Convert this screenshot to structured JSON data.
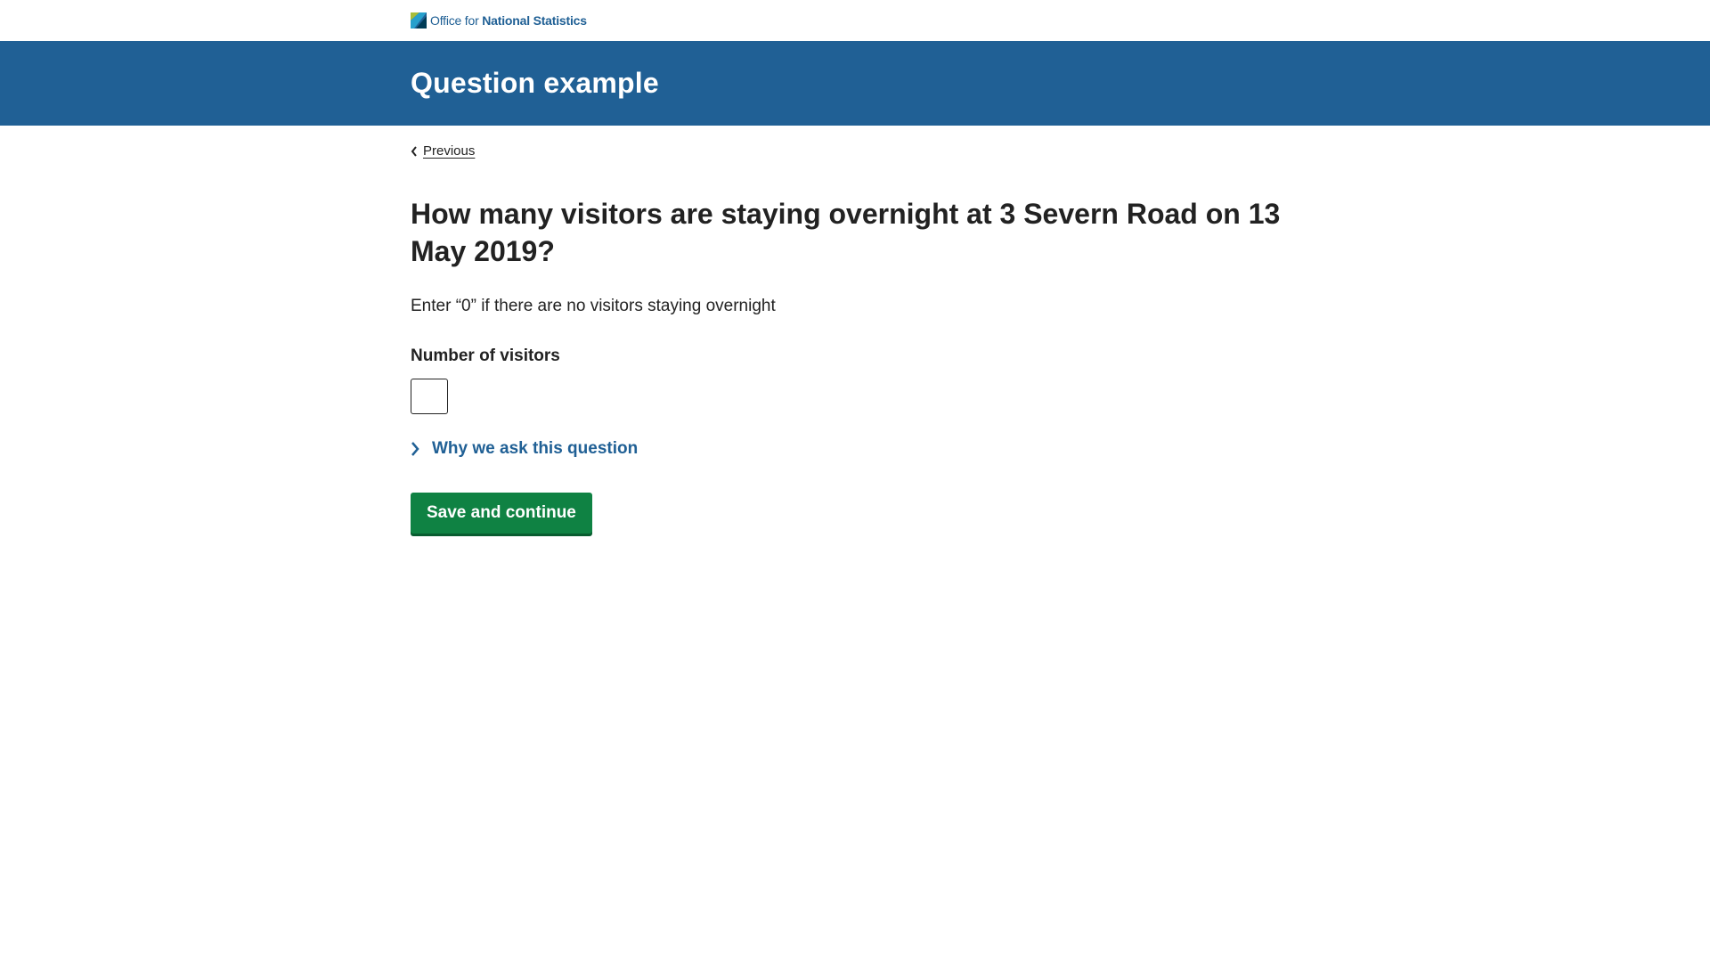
{
  "brand": {
    "logo_text_light": "Office for",
    "logo_text_bold": "National Statistics",
    "logo_icon": "ons-logo-icon"
  },
  "header": {
    "title": "Question example"
  },
  "nav": {
    "previous_label": "Previous",
    "previous_icon": "chevron-left-icon"
  },
  "question": {
    "title": "How many visitors are staying overnight at 3 Severn Road on 13 May 2019?",
    "hint": "Enter “0” if there are no visitors staying overnight",
    "field_label": "Number of visitors",
    "field_value": "",
    "details_label": "Why we ask this question",
    "details_icon": "chevron-right-icon"
  },
  "actions": {
    "save_label": "Save and continue"
  },
  "colors": {
    "header_blue": "#206095",
    "button_green": "#0f8243",
    "text": "#222222"
  }
}
